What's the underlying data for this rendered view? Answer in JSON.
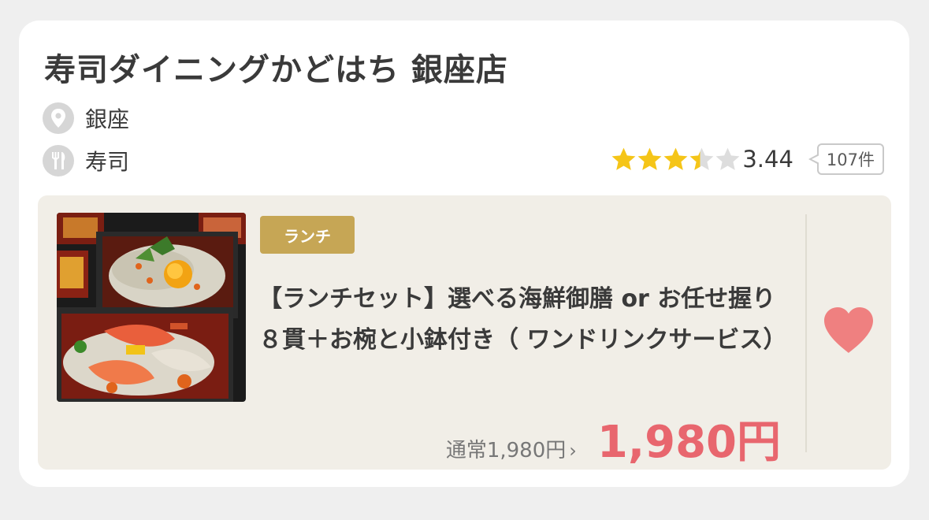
{
  "restaurant": {
    "name": "寿司ダイニングかどはち 銀座店",
    "area": "銀座",
    "genre": "寿司",
    "rating": {
      "score": "3.44",
      "stars": 3.44,
      "review_count": "107件"
    }
  },
  "plan": {
    "badge": "ランチ",
    "name": "【ランチセット】選べる海鮮御膳 or お任せ握り８貫＋お椀と小鉢付き（ ワンドリンクサービス）",
    "regular_price": "通常1,980円",
    "price": "1,980円",
    "favorite": true
  },
  "icons": {
    "area": "location-pin-icon",
    "genre": "fork-knife-icon",
    "favorite": "heart-icon",
    "chevron": "chevron-right-icon"
  },
  "colors": {
    "star": "#f5c518",
    "price": "#e8666e",
    "badge": "#c6a655",
    "heart": "#ef8080",
    "plan_background": "#f1eee7"
  }
}
